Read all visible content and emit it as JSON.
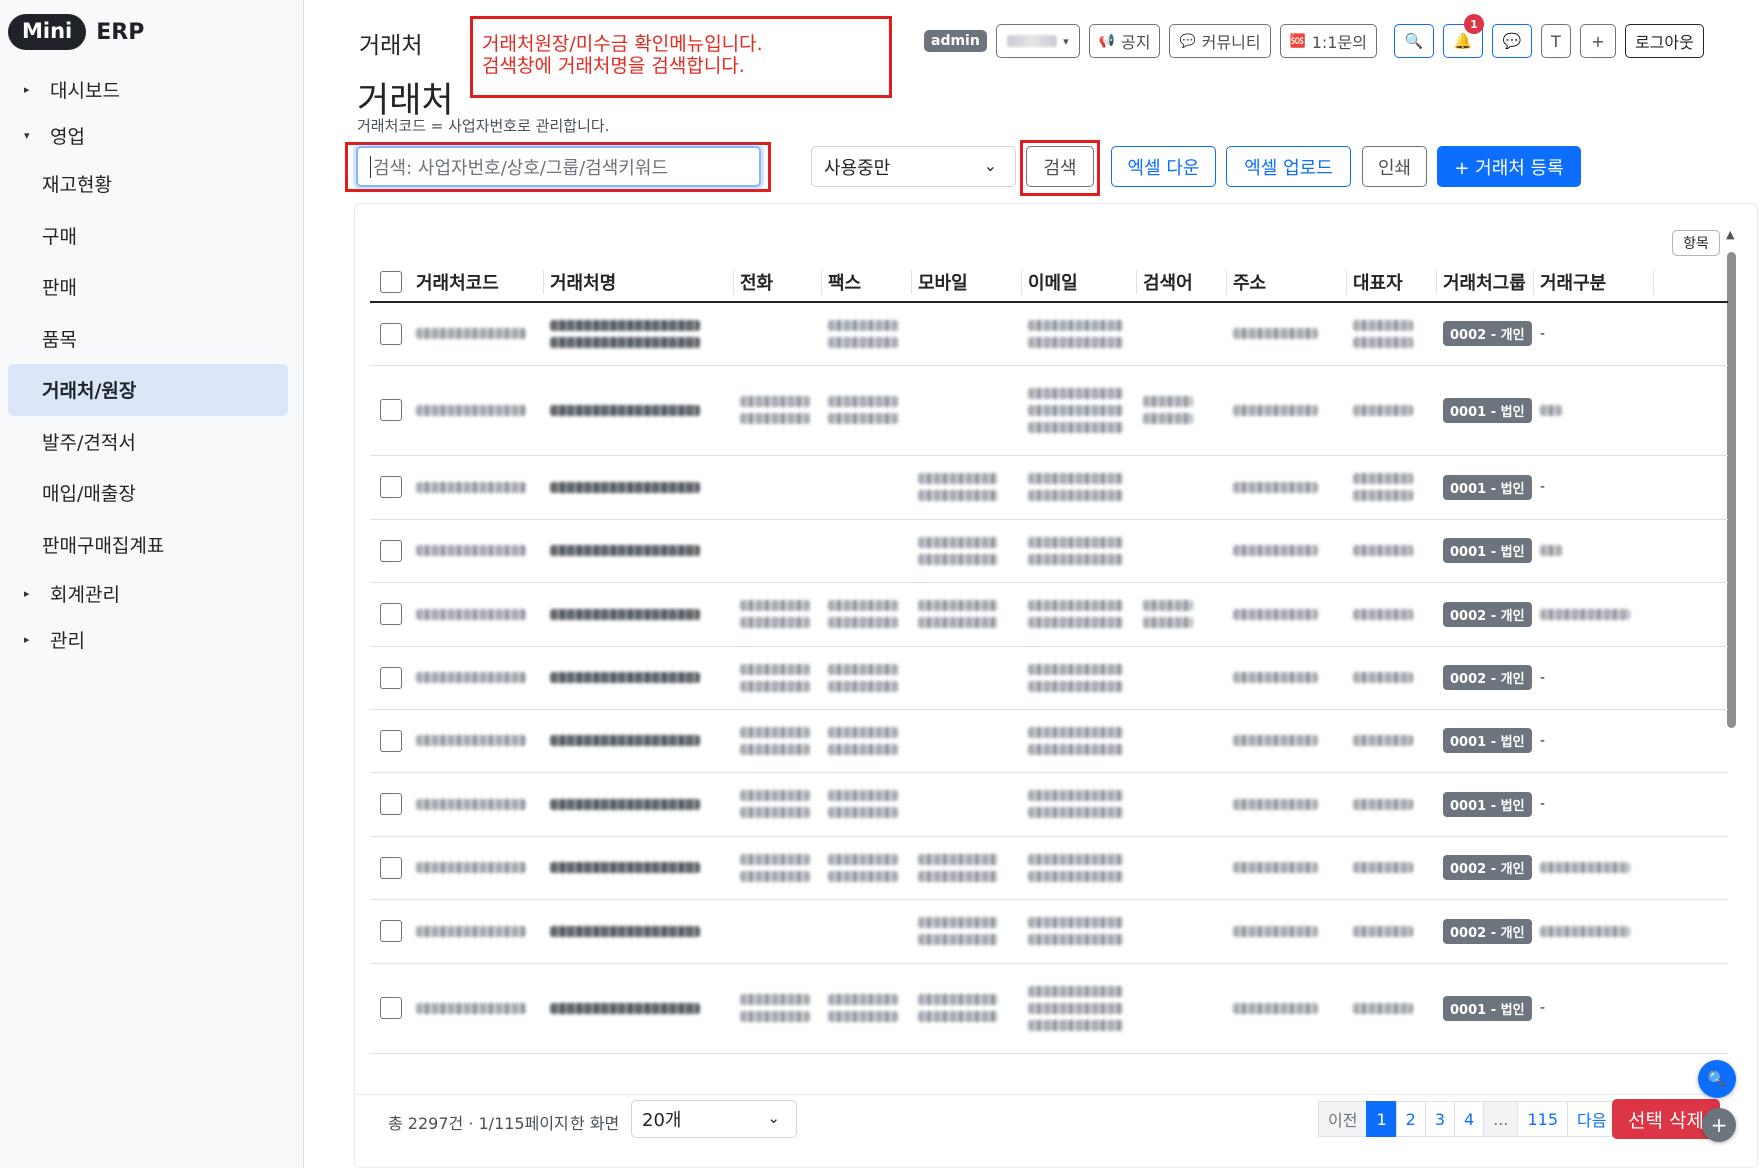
{
  "brand": {
    "pill": "Mini",
    "text": "ERP"
  },
  "sidebar": {
    "items": [
      {
        "label": "대시보드",
        "type": "group",
        "caret": "▸"
      },
      {
        "label": "영업",
        "type": "group",
        "caret": "▾"
      },
      {
        "label": "재고현황",
        "type": "item"
      },
      {
        "label": "구매",
        "type": "item"
      },
      {
        "label": "판매",
        "type": "item"
      },
      {
        "label": "품목",
        "type": "item"
      },
      {
        "label": "거래처/원장",
        "type": "item",
        "active": true
      },
      {
        "label": "발주/견적서",
        "type": "item"
      },
      {
        "label": "매입/매출장",
        "type": "item"
      },
      {
        "label": "판매구매집계표",
        "type": "item"
      },
      {
        "label": "회계관리",
        "type": "group",
        "caret": "▸"
      },
      {
        "label": "관리",
        "type": "group",
        "caret": "▸"
      }
    ]
  },
  "header": {
    "breadcrumb": "거래처",
    "title": "거래처",
    "subtitle": "거래처코드 = 사업자번호로 관리합니다."
  },
  "annotation": {
    "line1": "거래처원장/미수금 확인메뉴입니다.",
    "line2": "검색창에 거래처명을 검색합니다."
  },
  "topbar": {
    "admin_badge": "admin",
    "user_caret": "▾",
    "notice": "공지",
    "community": "커뮤니티",
    "inquiry": "1:1문의",
    "notif_count": "1",
    "t_button": "T",
    "plus_button": "+",
    "logout": "로그아웃",
    "icons": {
      "notice": "📢",
      "community": "💬",
      "inquiry": "🆘",
      "search": "🔍",
      "bell": "🔔",
      "chat": "💬"
    }
  },
  "toolbar": {
    "search_placeholder": "검색: 사업자번호/상호/그룹/검색키워드",
    "use_filter": "사용중만",
    "search": "검색",
    "excel_down": "엑셀 다운",
    "excel_up": "엑셀 업로드",
    "print": "인쇄",
    "register": "+ 거래처 등록",
    "column_settings": "항목"
  },
  "table": {
    "columns": [
      "거래처코드",
      "거래처명",
      "전화",
      "팩스",
      "모바일",
      "이메일",
      "검색어",
      "주소",
      "대표자",
      "거래처그룹",
      "거래구분"
    ],
    "rows": [
      {
        "group": "0002 - 개인",
        "type": "-"
      },
      {
        "group": "0001 - 법인",
        "type": ""
      },
      {
        "group": "0001 - 법인",
        "type": "-"
      },
      {
        "group": "0001 - 법인",
        "type": ""
      },
      {
        "group": "0002 - 개인",
        "type": ""
      },
      {
        "group": "0002 - 개인",
        "type": "-"
      },
      {
        "group": "0001 - 법인",
        "type": "-"
      },
      {
        "group": "0001 - 법인",
        "type": "-"
      },
      {
        "group": "0002 - 개인",
        "type": ""
      },
      {
        "group": "0002 - 개인",
        "type": ""
      },
      {
        "group": "0001 - 법인",
        "type": "-"
      }
    ]
  },
  "footer": {
    "total": "총 2297건 · 1/115페이지",
    "per_page_label": "한 화면",
    "per_page": "20개",
    "pager": {
      "prev": "이전",
      "pages": [
        "1",
        "2",
        "3",
        "4"
      ],
      "dots": "...",
      "last": "115",
      "next": "다음"
    },
    "delete": "선택 삭제"
  },
  "colors": {
    "primary": "#0d6efd",
    "danger": "#dc3545",
    "annotation": "#e01e1e",
    "sidebar_active": "#dbe7f9"
  }
}
